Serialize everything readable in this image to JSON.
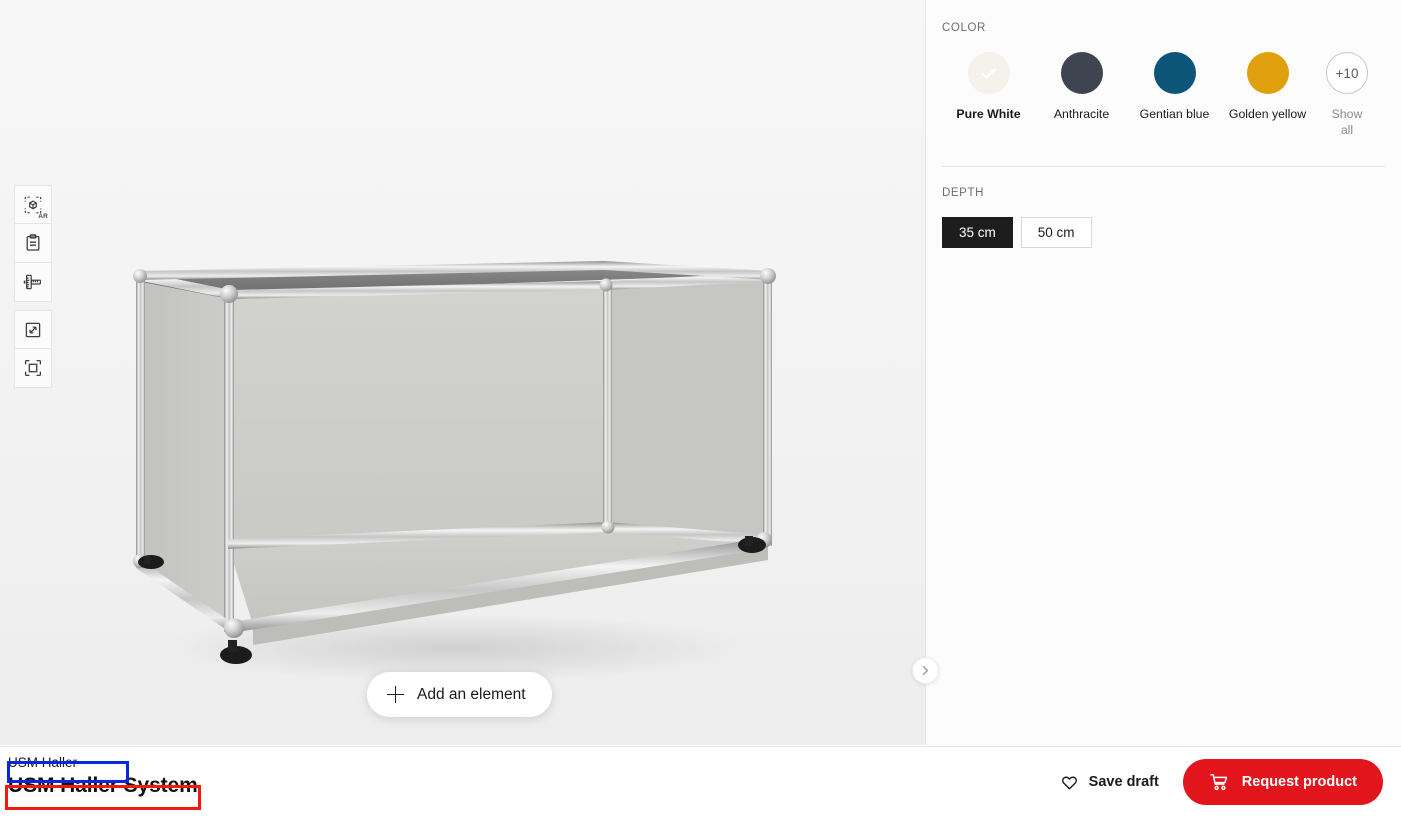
{
  "viewer": {
    "tools": [
      {
        "name": "ar-view",
        "label": "AR",
        "badge": "AR"
      },
      {
        "name": "specifications",
        "label": "Specifications"
      },
      {
        "name": "dimensions",
        "label": "Dimensions"
      },
      {
        "name": "fullscreen",
        "label": "Fullscreen"
      },
      {
        "name": "reset-view",
        "label": "Reset view"
      }
    ],
    "add_element_label": "Add an element",
    "collapse_panel_label": "›"
  },
  "panel": {
    "color": {
      "title": "COLOR",
      "options": [
        {
          "label": "Pure White",
          "hex": "#F5F2EC",
          "selected": true
        },
        {
          "label": "Anthracite",
          "hex": "#3E4450",
          "selected": false
        },
        {
          "label": "Gentian blue",
          "hex": "#0C5478",
          "selected": false
        },
        {
          "label": "Golden yellow",
          "hex": "#E0A00D",
          "selected": false
        }
      ],
      "show_all": {
        "count": "+10",
        "line1": "Show",
        "line2": "all"
      }
    },
    "depth": {
      "title": "DEPTH",
      "options": [
        {
          "label": "35 cm",
          "selected": true
        },
        {
          "label": "50 cm",
          "selected": false
        }
      ]
    }
  },
  "bottom": {
    "product_eyebrow": "USM Haller",
    "product_title": "USM Haller System",
    "save_draft_label": "Save draft",
    "request_label": "Request product"
  },
  "colors": {
    "accent_red": "#e2141c",
    "selected_chip": "#1d1d1d",
    "anno_blue": "#0a27e0",
    "anno_red": "#f11a0d"
  }
}
